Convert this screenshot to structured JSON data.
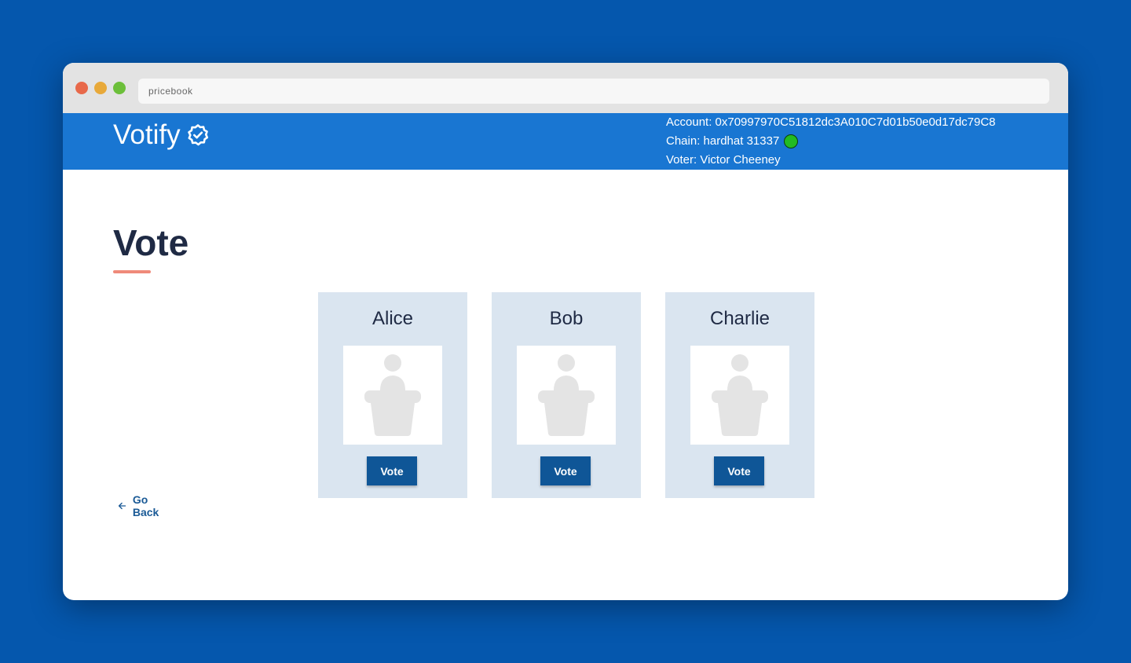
{
  "browser": {
    "url": "pricebook"
  },
  "navbar": {
    "brand": "Votify",
    "account_line": "Account: 0x70997970C51812dc3A010C7d01b50e0d17dc79C8",
    "chain_line": "Chain: hardhat 31337",
    "voter_line": "Voter: Victor Cheeney",
    "chain_status_color": "#22bb22"
  },
  "page": {
    "title": "Vote",
    "go_back_label": "Go Back"
  },
  "candidates": [
    {
      "name": "Alice",
      "vote_label": "Vote",
      "icon": "speaker-podium-icon"
    },
    {
      "name": "Bob",
      "vote_label": "Vote",
      "icon": "speaker-podium-icon"
    },
    {
      "name": "Charlie",
      "vote_label": "Vote",
      "icon": "speaker-podium-icon"
    }
  ],
  "colors": {
    "background": "#0557ad",
    "navbar": "#1976d2",
    "card": "#dae5f0",
    "button": "#0f5697",
    "accent_underline": "#ef8a7a"
  }
}
